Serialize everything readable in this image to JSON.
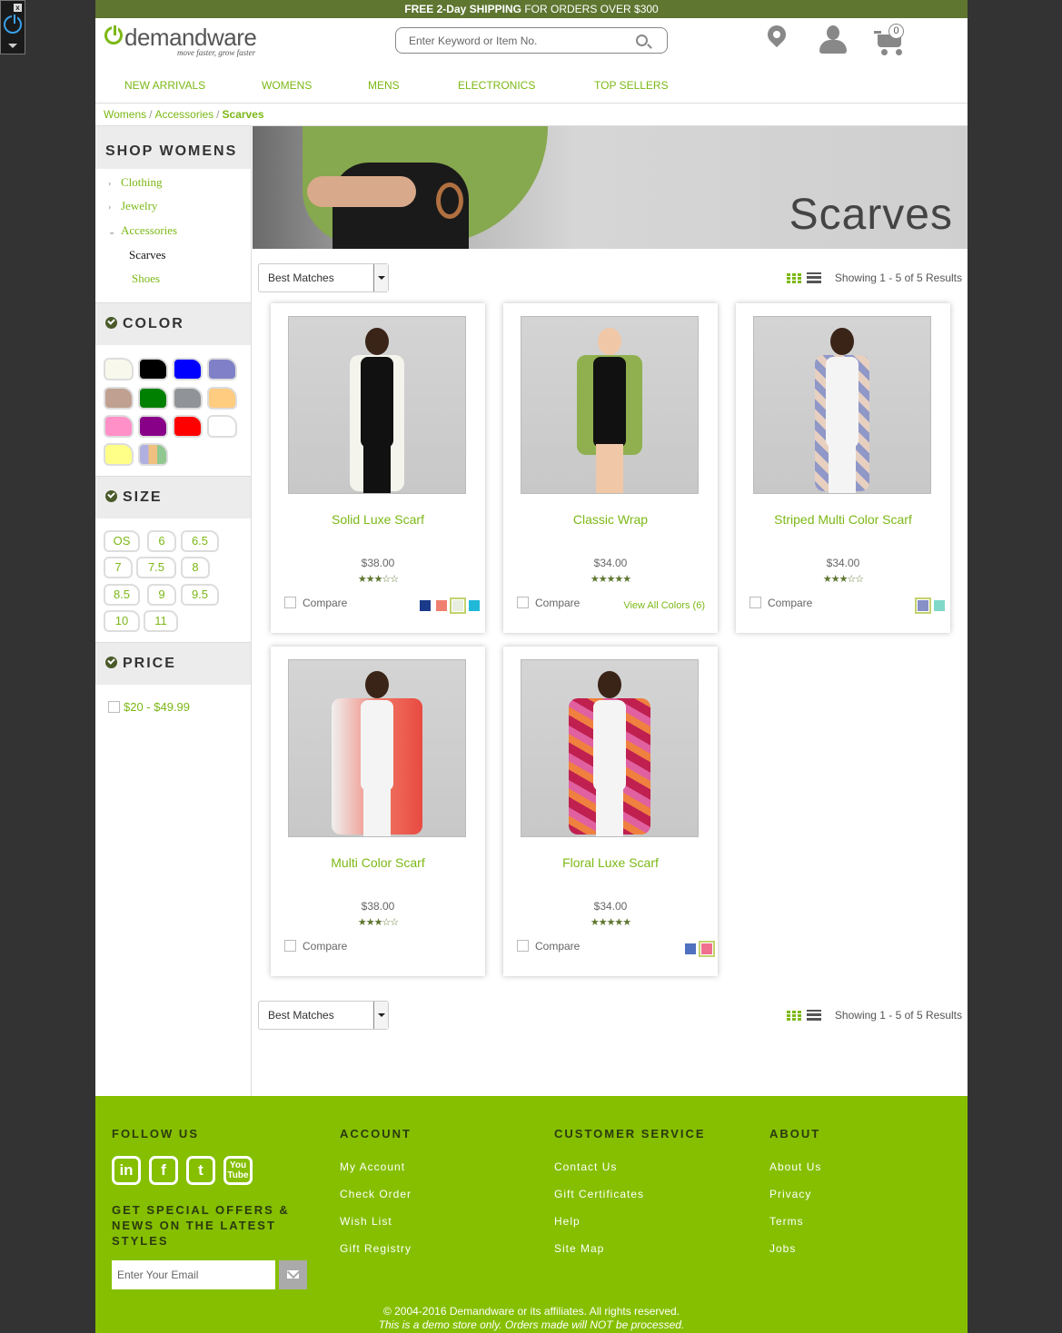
{
  "debug_widget": {
    "close": "x"
  },
  "promo": {
    "bold": "FREE 2-Day",
    "bold2": "SHIPPING",
    "rest": "FOR ORDERS OVER $300"
  },
  "header": {
    "logo_name": "demandware",
    "logo_tagline": "move faster, grow faster",
    "search_placeholder": "Enter Keyword or Item No.",
    "cart_count": "0",
    "icons": {
      "store": "map-pin-icon",
      "account": "user-icon",
      "cart": "cart-icon",
      "search": "search-icon"
    }
  },
  "nav": [
    "NEW ARRIVALS",
    "WOMENS",
    "MENS",
    "ELECTRONICS",
    "TOP SELLERS"
  ],
  "breadcrumb": [
    "Womens",
    "Accessories",
    "Scarves"
  ],
  "sidebar": {
    "shop_title": "SHOP WOMENS",
    "categories": [
      "Clothing",
      "Jewelry",
      "Accessories"
    ],
    "subcategories": [
      "Scarves",
      "Shoes"
    ],
    "color_title": "COLOR",
    "colors": [
      "#f8f8ec",
      "#000000",
      "#0000ff",
      "#8080c8",
      "#c0a090",
      "#008000",
      "#909498",
      "#ffcc80",
      "#ff90c8",
      "#880088",
      "#ff0000",
      "#ffffff",
      "#ffff88",
      "miscellaneous"
    ],
    "size_title": "SIZE",
    "sizes": [
      "OS",
      "6",
      "6.5",
      "7",
      "7.5",
      "8",
      "8.5",
      "9",
      "9.5",
      "10",
      "11"
    ],
    "price_title": "PRICE",
    "price_range": "$20 - $49.99"
  },
  "banner": {
    "title": "Scarves"
  },
  "sort": {
    "selected": "Best Matches",
    "showing": "Showing 1 - 5 of 5 Results"
  },
  "products": [
    {
      "name": "Solid Luxe Scarf",
      "price": "$38.00",
      "rating": 3,
      "compare": "Compare",
      "swatches": [
        "#1a3a8a",
        "#f08070",
        "#e8eee0",
        "#20b8d8"
      ],
      "selected_swatch": 2
    },
    {
      "name": "Classic Wrap",
      "price": "$34.00",
      "rating": 4.5,
      "compare": "Compare",
      "view_all": "View All Colors (6)"
    },
    {
      "name": "Striped Multi Color Scarf",
      "price": "$34.00",
      "rating": 3,
      "compare": "Compare",
      "swatches": [
        "#8890c8",
        "#80d8c8"
      ],
      "selected_swatch": 0
    },
    {
      "name": "Multi Color Scarf",
      "price": "$38.00",
      "rating": 3,
      "compare": "Compare"
    },
    {
      "name": "Floral Luxe Scarf",
      "price": "$34.00",
      "rating": 4.5,
      "compare": "Compare",
      "swatches": [
        "#5070c0",
        "#f07090"
      ],
      "selected_swatch": 1
    }
  ],
  "footer": {
    "follow_title": "FOLLOW US",
    "social": [
      "in",
      "f",
      "t",
      "You Tube"
    ],
    "offers_title": "GET SPECIAL OFFERS & NEWS ON THE LATEST STYLES",
    "email_placeholder": "Enter Your Email",
    "account_title": "ACCOUNT",
    "account_links": [
      "My Account",
      "Check Order",
      "Wish List",
      "Gift Registry"
    ],
    "service_title": "CUSTOMER SERVICE",
    "service_links": [
      "Contact Us",
      "Gift Certificates",
      "Help",
      "Site Map"
    ],
    "about_title": "ABOUT",
    "about_links": [
      "About Us",
      "Privacy",
      "Terms",
      "Jobs"
    ],
    "copyright": "© 2004-2016 Demandware or its affiliates. All rights reserved.",
    "demo_notice": "This is a demo store only. Orders made will NOT be processed."
  }
}
